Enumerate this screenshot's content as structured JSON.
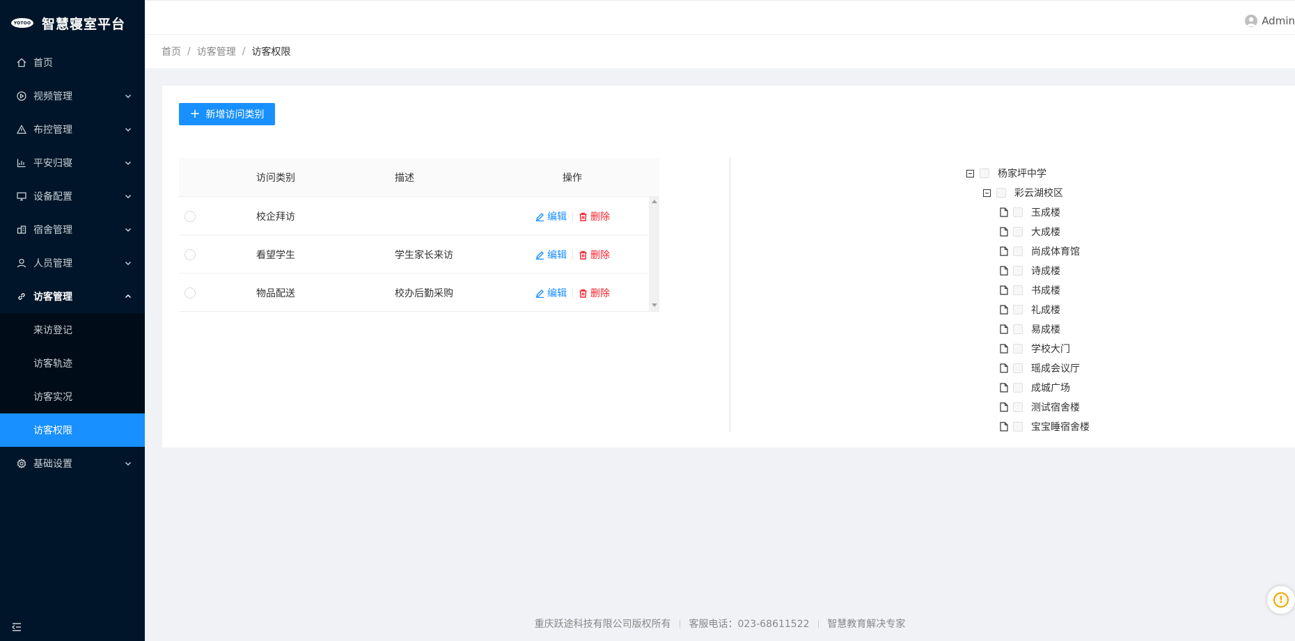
{
  "app": {
    "logo_badge": "YOTOO",
    "title": "智慧寝室平台"
  },
  "sidebar": {
    "items": [
      {
        "label": "首页",
        "icon": "home-icon"
      },
      {
        "label": "视频管理",
        "icon": "play-circle-icon"
      },
      {
        "label": "布控管理",
        "icon": "warning-icon"
      },
      {
        "label": "平安归寝",
        "icon": "bar-chart-icon"
      },
      {
        "label": "设备配置",
        "icon": "monitor-icon"
      },
      {
        "label": "宿舍管理",
        "icon": "building-icon"
      },
      {
        "label": "人员管理",
        "icon": "user-icon"
      },
      {
        "label": "访客管理",
        "icon": "link-icon"
      },
      {
        "label": "基础设置",
        "icon": "gear-icon"
      }
    ],
    "visitor_sub": [
      "来访登记",
      "访客轨迹",
      "访客实况",
      "访客权限"
    ]
  },
  "header": {
    "user": "Admin"
  },
  "breadcrumb": [
    "首页",
    "访客管理",
    "访客权限"
  ],
  "toolbar": {
    "add_label": "新增访问类别"
  },
  "table": {
    "headers": {
      "type": "访问类别",
      "desc": "描述",
      "op": "操作"
    },
    "edit_label": "编辑",
    "delete_label": "删除",
    "rows": [
      {
        "type": "校企拜访",
        "desc": ""
      },
      {
        "type": "看望学生",
        "desc": "学生家长来访"
      },
      {
        "type": "物品配送",
        "desc": "校办后勤采购"
      }
    ]
  },
  "tree": {
    "root": "杨家坪中学",
    "campus": "彩云湖校区",
    "buildings": [
      "玉成楼",
      "大成楼",
      "尚成体育馆",
      "诗成楼",
      "书成楼",
      "礼成楼",
      "易成楼",
      "学校大门",
      "瑶成会议厅",
      "成城广场",
      "测试宿舍楼",
      "宝宝睡宿舍楼"
    ]
  },
  "footer": {
    "company": "重庆跃途科技有限公司版权所有",
    "phone": "客服电话：023-68611522",
    "slogan": "智慧教育解决专家"
  },
  "float_help": {
    "glyph": "!"
  },
  "colors": {
    "primary": "#1890ff",
    "danger": "#f5222d",
    "sidebar": "#001529"
  }
}
